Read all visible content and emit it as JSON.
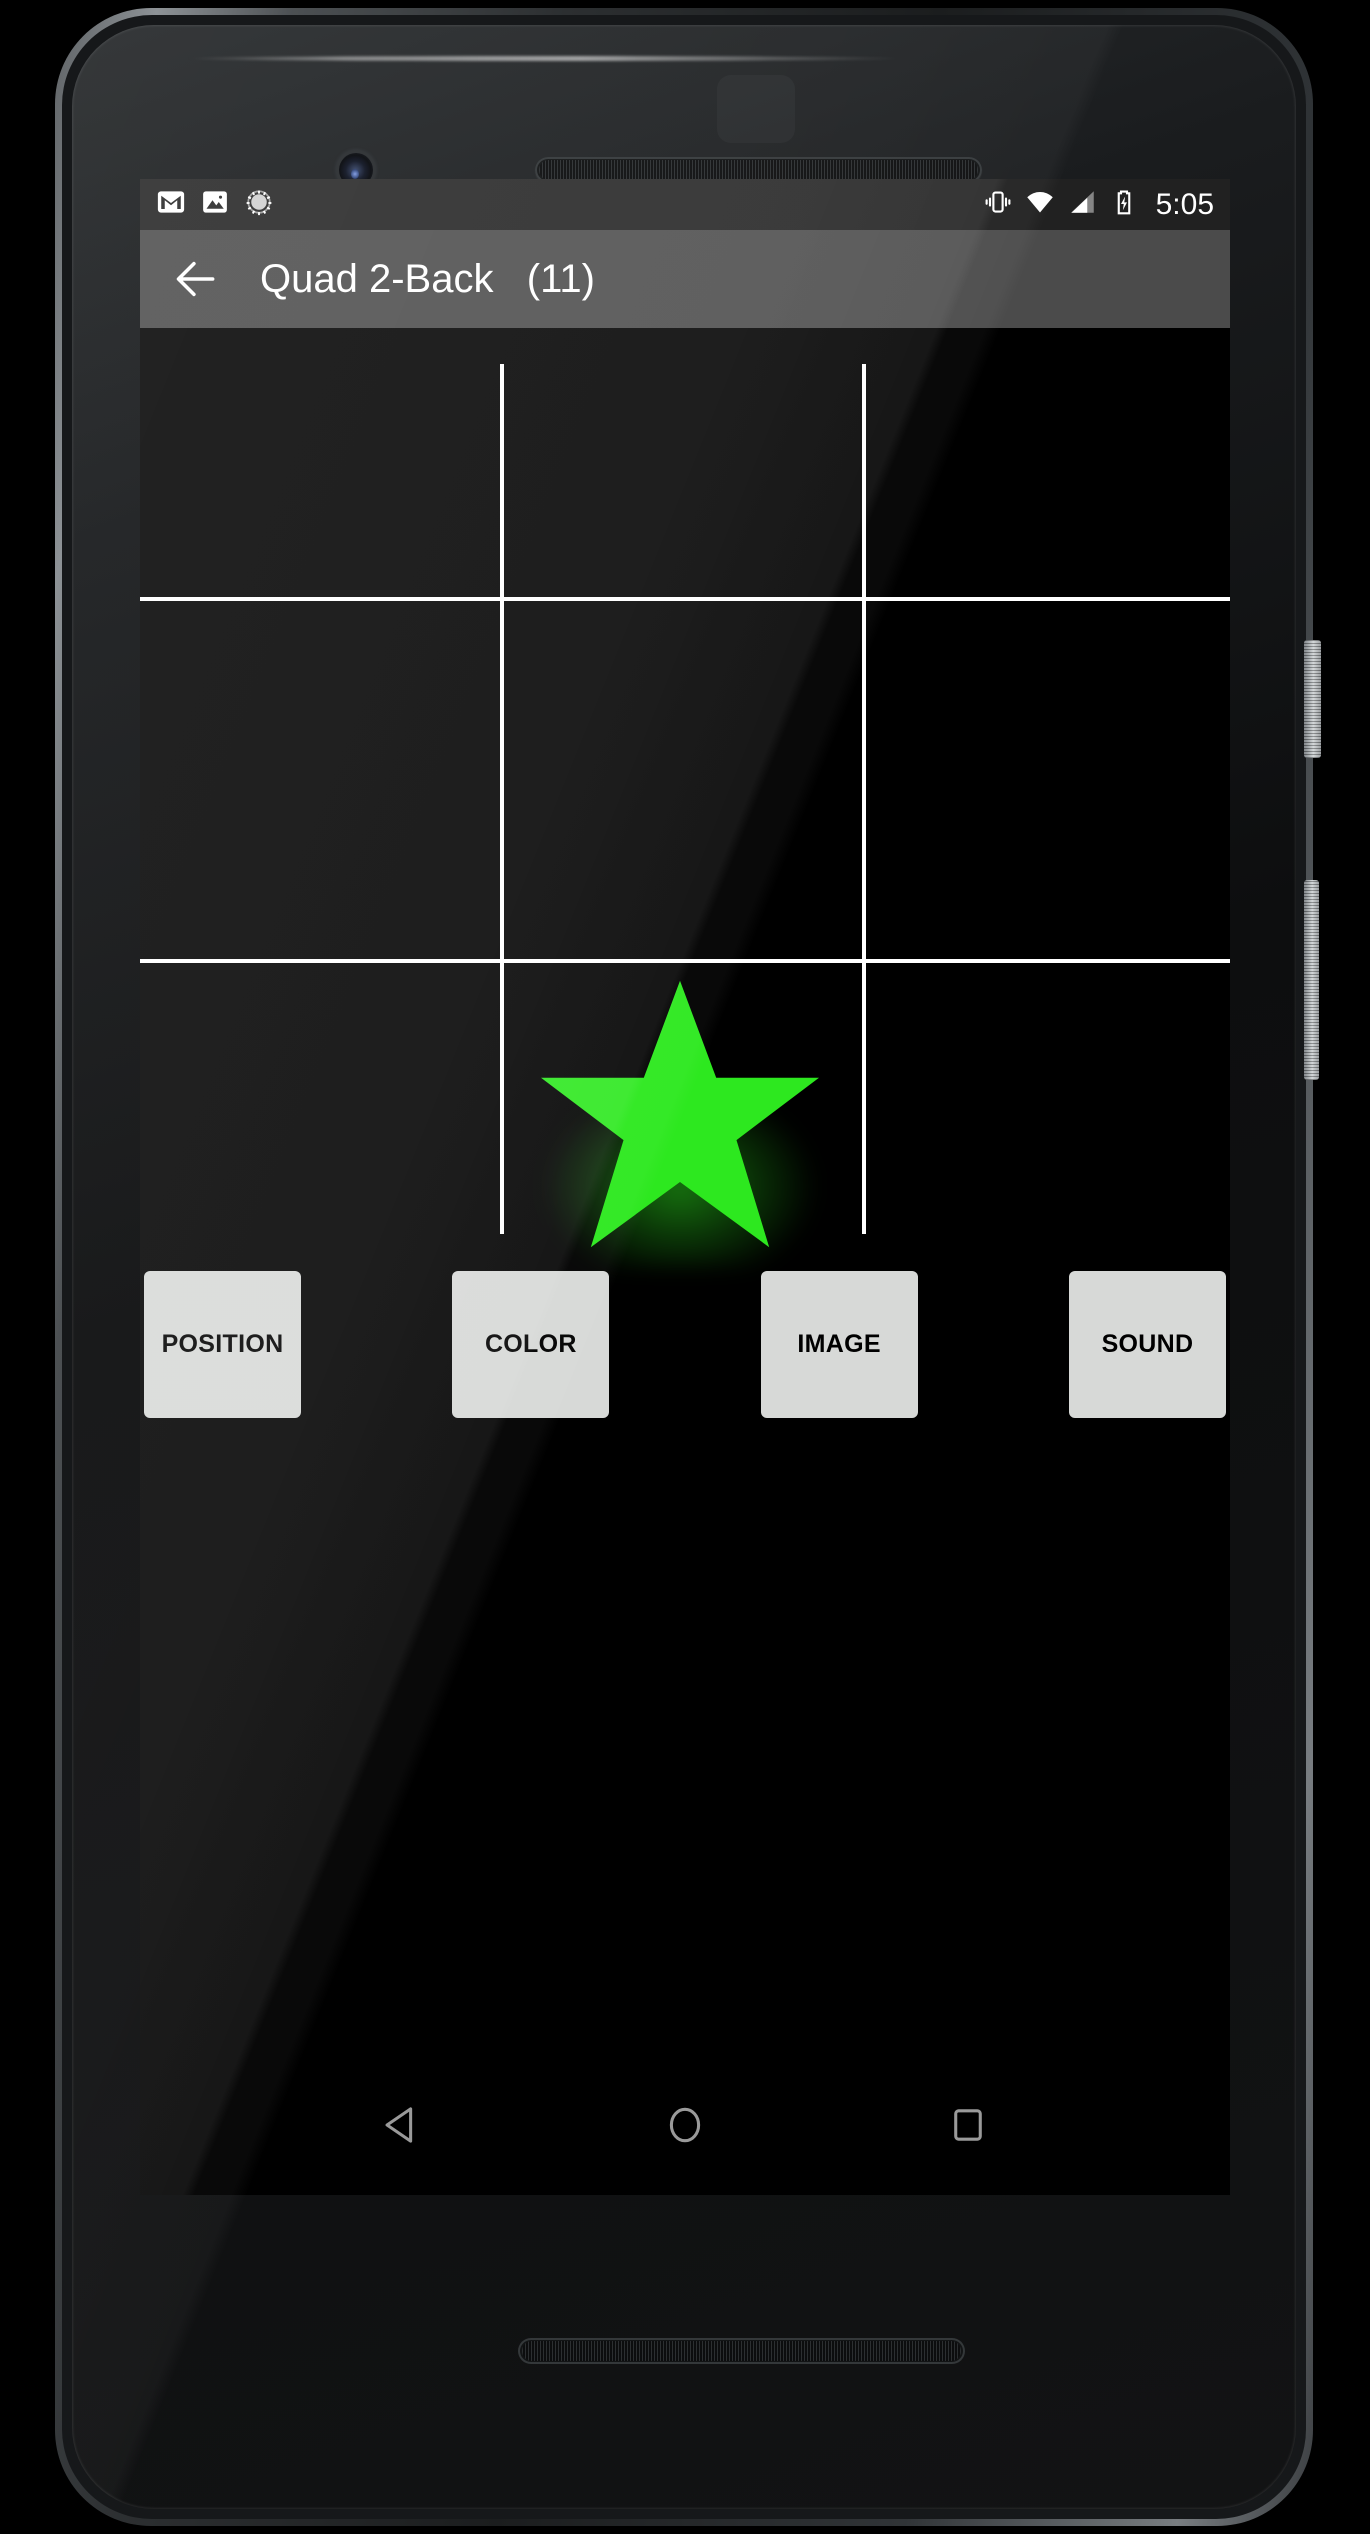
{
  "status_bar": {
    "left_icons": [
      {
        "name": "gmail-icon",
        "label": "Gmail"
      },
      {
        "name": "photos-icon",
        "label": "Photos"
      },
      {
        "name": "sync-progress-icon",
        "label": "Sync"
      }
    ],
    "right_icons": [
      {
        "name": "vibrate-mode-icon",
        "label": "Vibrate"
      },
      {
        "name": "wifi-icon",
        "label": "Wi-Fi"
      },
      {
        "name": "cellular-signal-icon",
        "label": "Signal"
      },
      {
        "name": "battery-charging-icon",
        "label": "Battery charging"
      }
    ],
    "clock": "5:05",
    "background_color": "#212121",
    "foreground_color": "#ffffff"
  },
  "app_bar": {
    "back_label": "Back",
    "title": "Quad 2-Back   (11)",
    "game_mode": "Quad 2-Back",
    "trial_counter": "(11)",
    "background_color": "#4b4b4b",
    "title_color": "#ffffff"
  },
  "game": {
    "grid": {
      "rows": 3,
      "columns": 3,
      "line_color": "#ffffff",
      "background_color": "#000000"
    },
    "stimulus": {
      "shape": "star",
      "color": "#2de81f",
      "cell_row": 3,
      "cell_column": 2,
      "cell_index": 7,
      "glow": true
    }
  },
  "answer_buttons": [
    {
      "name": "position-button",
      "label": "POSITION"
    },
    {
      "name": "color-button",
      "label": "COLOR"
    },
    {
      "name": "image-button",
      "label": "IMAGE"
    },
    {
      "name": "sound-button",
      "label": "SOUND"
    }
  ],
  "answer_button_style": {
    "background_color": "#d7d9d7",
    "text_color": "#000000"
  },
  "nav_bar": {
    "buttons": [
      {
        "name": "nav-back-button",
        "label": "Back"
      },
      {
        "name": "nav-home-button",
        "label": "Home"
      },
      {
        "name": "nav-recents-button",
        "label": "Recents"
      }
    ],
    "icon_color": "#9a9a9a",
    "background_color": "#000000"
  },
  "device": {
    "front_camera": "front-camera",
    "earpiece": "earpiece-speaker",
    "bottom_speaker": "bottom-speaker",
    "power_button": "power-button",
    "volume_button": "volume-button"
  }
}
